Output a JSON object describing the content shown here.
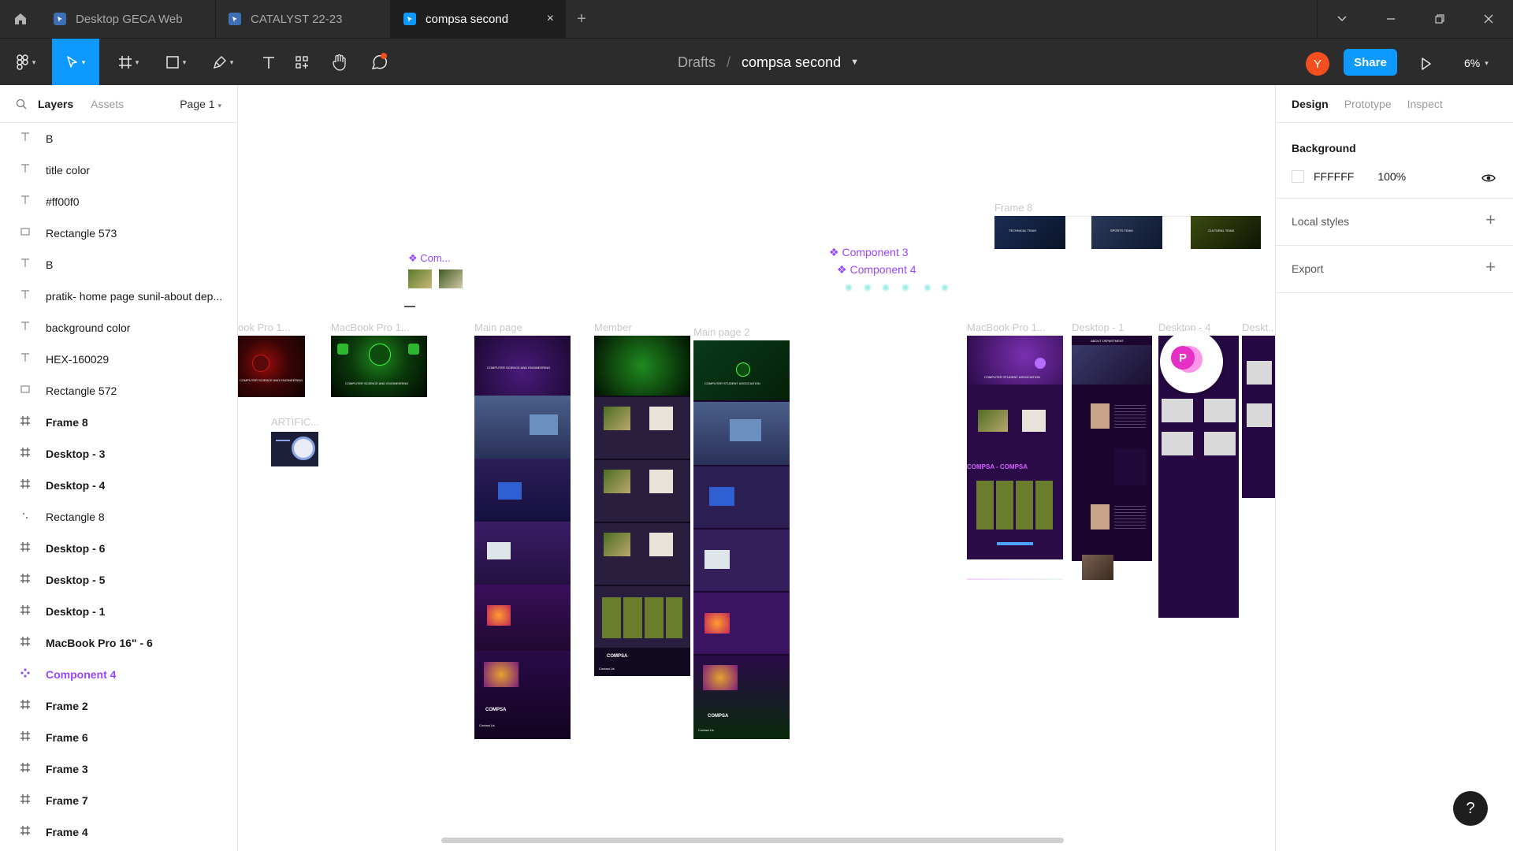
{
  "titlebar": {
    "tabs": [
      {
        "label": "Desktop GECA Web",
        "active": false
      },
      {
        "label": "CATALYST 22-23",
        "active": false
      },
      {
        "label": "compsa second",
        "active": true
      }
    ],
    "close_glyph": "×",
    "add_glyph": "+"
  },
  "toolbar": {
    "breadcrumb_parent": "Drafts",
    "breadcrumb_sep": "/",
    "file_name": "compsa second",
    "avatar_initial": "Y",
    "share_label": "Share",
    "zoom": "6%"
  },
  "left_panel": {
    "tab_layers": "Layers",
    "tab_assets": "Assets",
    "page": "Page 1",
    "layers": [
      {
        "type": "text",
        "name": "B"
      },
      {
        "type": "text",
        "name": "title color"
      },
      {
        "type": "text",
        "name": "#ff00f0"
      },
      {
        "type": "rect",
        "name": "Rectangle 573"
      },
      {
        "type": "text",
        "name": "B"
      },
      {
        "type": "text",
        "name": "pratik- home page sunil-about dep..."
      },
      {
        "type": "text",
        "name": "background color"
      },
      {
        "type": "text",
        "name": "HEX-160029"
      },
      {
        "type": "rect",
        "name": "Rectangle 572"
      },
      {
        "type": "frame",
        "name": "Frame 8"
      },
      {
        "type": "frame",
        "name": "Desktop - 3"
      },
      {
        "type": "frame",
        "name": "Desktop - 4"
      },
      {
        "type": "vector",
        "name": "Rectangle 8"
      },
      {
        "type": "frame",
        "name": "Desktop - 6"
      },
      {
        "type": "frame",
        "name": "Desktop - 5"
      },
      {
        "type": "frame",
        "name": "Desktop - 1"
      },
      {
        "type": "frame",
        "name": "MacBook Pro 16\" - 6"
      },
      {
        "type": "component",
        "name": "Component 4"
      },
      {
        "type": "frame",
        "name": "Frame 2"
      },
      {
        "type": "frame",
        "name": "Frame 6"
      },
      {
        "type": "frame",
        "name": "Frame 3"
      },
      {
        "type": "frame",
        "name": "Frame 7"
      },
      {
        "type": "frame",
        "name": "Frame 4"
      }
    ]
  },
  "canvas": {
    "labels": {
      "macbook_a": "ook Pro 1...",
      "macbook_b": "MacBook Pro 1...",
      "main_page": "Main page",
      "member": "Member",
      "main_page_2": "Main page 2",
      "artific": "ARTIFIC...",
      "component_small": "Com...",
      "component_3": "Component 3",
      "component_4": "Component 4",
      "frame_8": "Frame 8",
      "macbook_c": "MacBook Pro 1...",
      "desktop_1": "Desktop - 1",
      "desktop_4": "Desktop - 4",
      "desktop_cut": "Deskt..."
    },
    "mini_text": {
      "site_title": "COMPUTER SCIENCE AND ENGINEERING",
      "compsa": "COMPSA",
      "compsa_full": "COMPUTER STUDENT ASSOCIATION",
      "about_dept": "ABOUT DEPARTMENT",
      "compsa_compsa": "COMPSA - COMPSA",
      "technical_team": "TECHNICAL TEAM",
      "sports_team": "SPORTS TEAM",
      "cultural_team": "CULTURAL TEAM",
      "contact": "Contact Us",
      "cursor_initial": "P"
    }
  },
  "right_panel": {
    "tabs": [
      "Design",
      "Prototype",
      "Inspect"
    ],
    "background_title": "Background",
    "bg_hex": "FFFFFF",
    "bg_opacity": "100%",
    "local_styles": "Local styles",
    "export": "Export"
  },
  "help_glyph": "?"
}
